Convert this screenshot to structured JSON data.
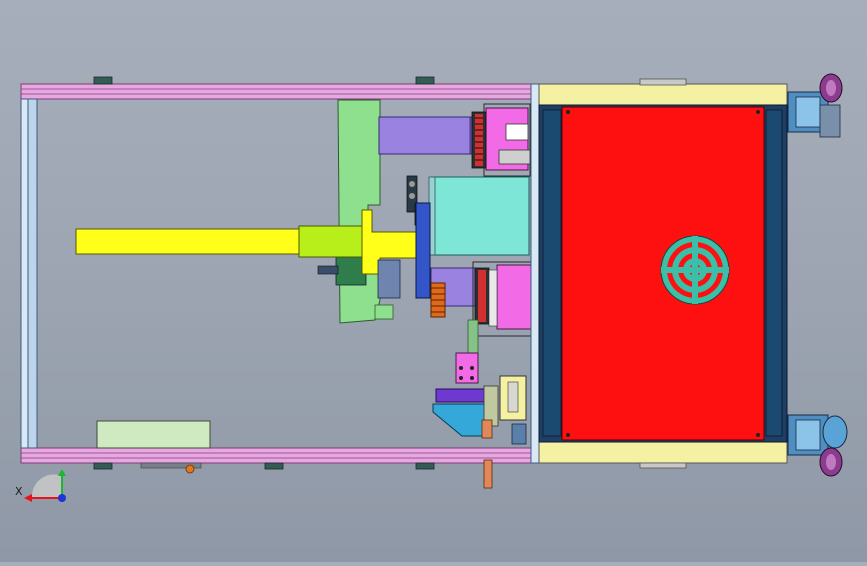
{
  "viewport": {
    "background_top": "#a7aebb",
    "background_bottom": "#8f98a6"
  },
  "triad": {
    "x_label": "X",
    "x_color": "#e8141c",
    "y_color": "#18b833",
    "z_color": "#1d33d6"
  },
  "colors": {
    "frame_rail": "#e9a7e2",
    "frame_edge": "#7a3f77",
    "frame_post": "#cfe3f0",
    "panel_red": "#ff1010",
    "panel_yellow": "#f4f1a2",
    "panel_border": "#1f3e66",
    "slide_yellow": "#ffff1a",
    "cyan_block": "#7de6d7",
    "violet_block": "#9a82e0",
    "magenta_block": "#f36ae6",
    "green_bracket": "#8fe08e",
    "fan_grille": "#3bbfa8",
    "wheel_blue": "#5aa3d6",
    "wheel_purple": "#8b3c8f"
  }
}
